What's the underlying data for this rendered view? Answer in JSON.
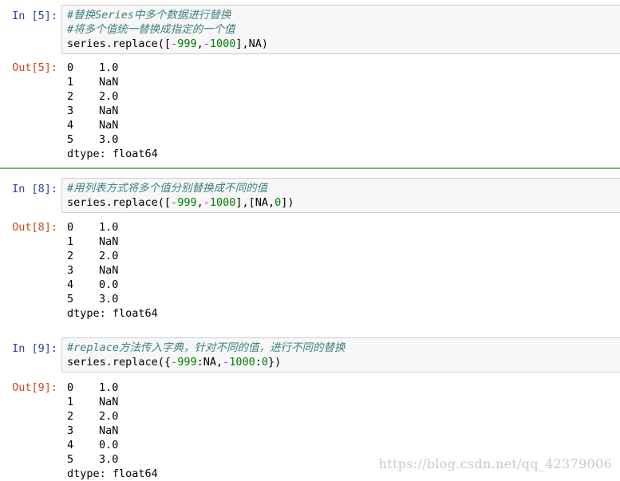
{
  "cells": [
    {
      "in_prompt": "In [5]:",
      "code": {
        "comment1": "#替换Series中多个数据进行替换",
        "comment2": "#将多个值统一替换成指定的一个值",
        "line": {
          "pre": "series.replace([",
          "m1": "-",
          "n1": "999",
          "sep": ",",
          "m2": "-",
          "n2": "1000",
          "post": "],NA)"
        }
      },
      "out_prompt": "Out[5]:",
      "output": [
        {
          "idx": "0",
          "val": "1.0"
        },
        {
          "idx": "1",
          "val": "NaN"
        },
        {
          "idx": "2",
          "val": "2.0"
        },
        {
          "idx": "3",
          "val": "NaN"
        },
        {
          "idx": "4",
          "val": "NaN"
        },
        {
          "idx": "5",
          "val": "3.0"
        }
      ],
      "dtype": "dtype: float64"
    },
    {
      "in_prompt": "In [8]:",
      "code": {
        "comment1": "#用列表方式将多个值分别替换成不同的值",
        "line": {
          "pre": "series.replace([",
          "m1": "-",
          "n1": "999",
          "sep": ",",
          "m2": "-",
          "n2": "1000",
          "mid": "],[NA,",
          "n3": "0",
          "post": "])"
        }
      },
      "out_prompt": "Out[8]:",
      "output": [
        {
          "idx": "0",
          "val": "1.0"
        },
        {
          "idx": "1",
          "val": "NaN"
        },
        {
          "idx": "2",
          "val": "2.0"
        },
        {
          "idx": "3",
          "val": "NaN"
        },
        {
          "idx": "4",
          "val": "0.0"
        },
        {
          "idx": "5",
          "val": "3.0"
        }
      ],
      "dtype": "dtype: float64"
    },
    {
      "in_prompt": "In [9]:",
      "code": {
        "comment1": "#replace方法传入字典，针对不同的值，进行不同的替换",
        "line": {
          "pre": "series.replace({",
          "m1": "-",
          "n1": "999",
          "mid1": ":NA,",
          "m2": "-",
          "n2": "1000",
          "mid2": ":",
          "n3": "0",
          "post": "})"
        }
      },
      "out_prompt": "Out[9]:",
      "output": [
        {
          "idx": "0",
          "val": "1.0"
        },
        {
          "idx": "1",
          "val": "NaN"
        },
        {
          "idx": "2",
          "val": "2.0"
        },
        {
          "idx": "3",
          "val": "NaN"
        },
        {
          "idx": "4",
          "val": "0.0"
        },
        {
          "idx": "5",
          "val": "3.0"
        }
      ],
      "dtype": "dtype: float64"
    }
  ],
  "watermark": "https://blog.csdn.net/qq_42379006",
  "colors": {
    "in_prompt": "#303f9f",
    "out_prompt": "#d84315",
    "comment": "#408080",
    "number": "#008000",
    "operator": "#aa22ff",
    "selected_bar": "#66bb6a"
  }
}
